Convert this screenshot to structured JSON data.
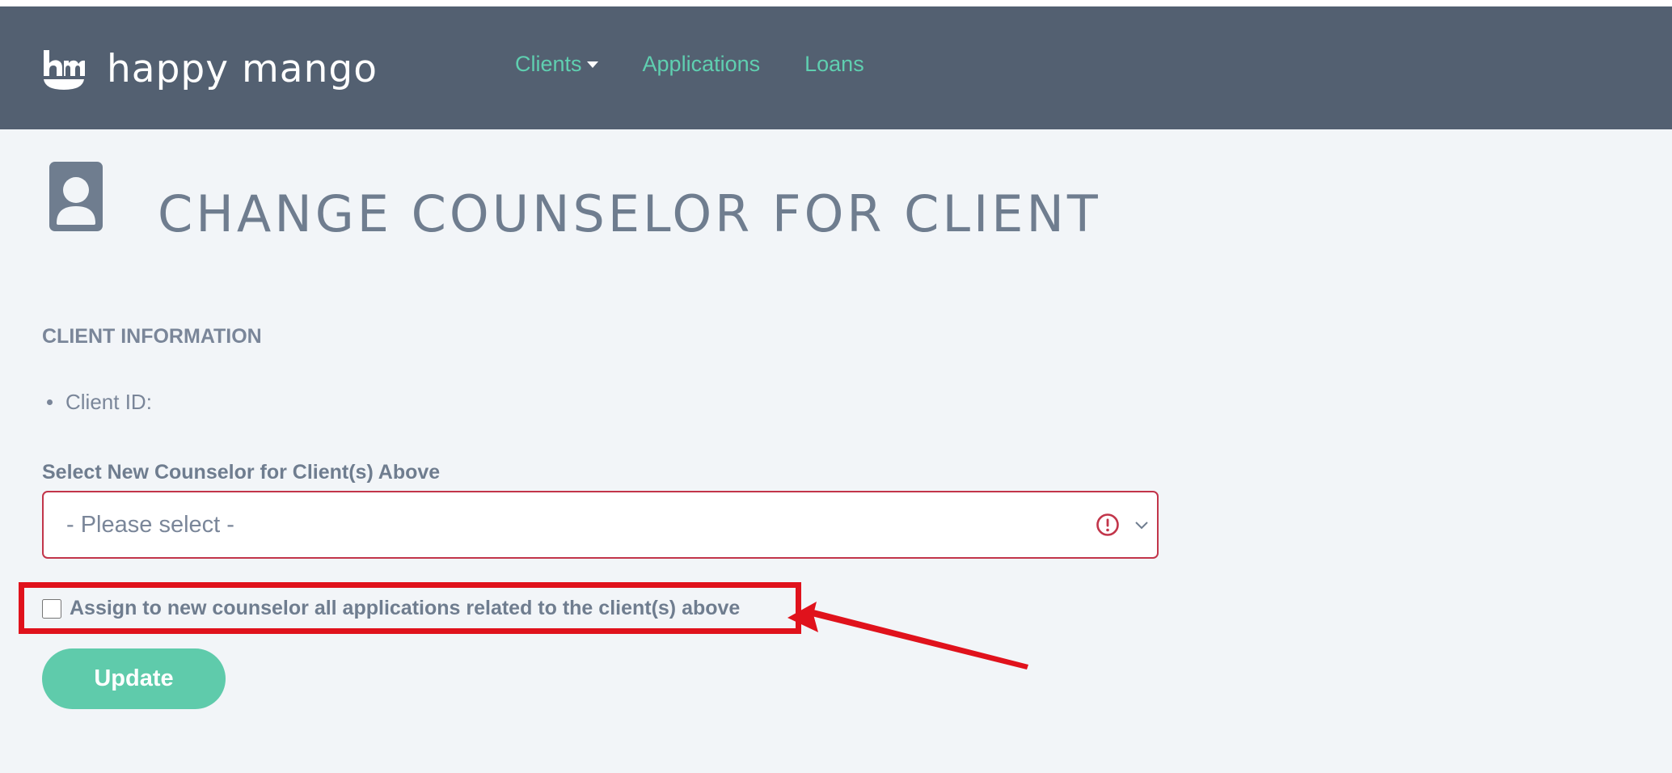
{
  "header": {
    "brand_name": "happy mango",
    "nav": [
      {
        "label": "Clients",
        "has_dropdown": true
      },
      {
        "label": "Applications"
      },
      {
        "label": "Loans"
      }
    ]
  },
  "page": {
    "title": "CHANGE COUNSELOR FOR CLIENT",
    "icon": "person-id-icon"
  },
  "client_info": {
    "heading": "CLIENT INFORMATION",
    "items": [
      {
        "label": "Client ID:"
      }
    ]
  },
  "form": {
    "counselor_label": "Select New Counselor for Client(s) Above",
    "counselor_select_value": "- Please select -",
    "assign_checkbox_label": "Assign to new counselor all applications related to the client(s) above",
    "assign_checked": false,
    "update_label": "Update"
  },
  "colors": {
    "navbar": "#536071",
    "accent": "#5fcfb0",
    "error": "#c2354a",
    "annotation": "#e0121c"
  }
}
